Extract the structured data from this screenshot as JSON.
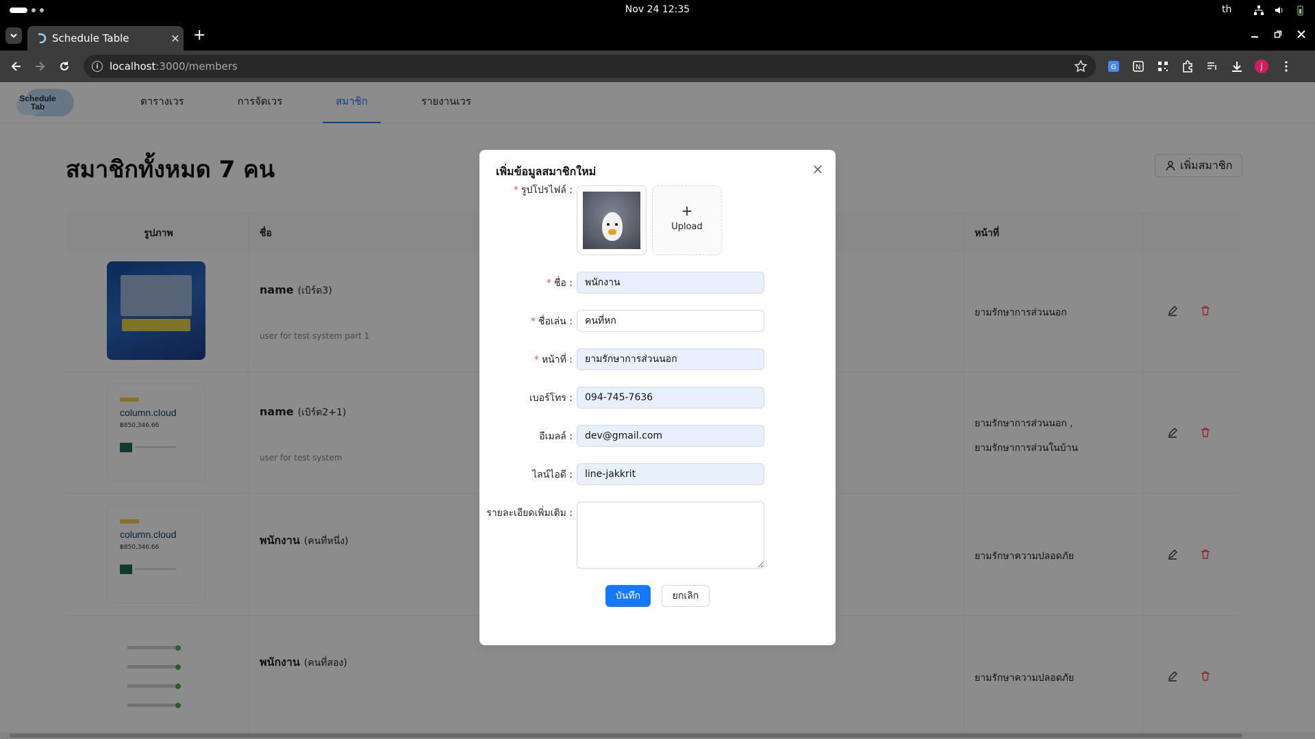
{
  "os": {
    "clock": "Nov 24  12:35",
    "lang": "th"
  },
  "browser": {
    "tab_title": "Schedule Table",
    "new_tab": "+",
    "url_host": "localhost",
    "url_path": ":3000/members",
    "profile_initial": "j"
  },
  "app": {
    "logo_line1": "Schedule",
    "logo_line2": "Tab",
    "nav": [
      "ตารางเวร",
      "การจัดเวร",
      "สมาชิก",
      "รายงานเวร"
    ],
    "active_nav": "สมาชิก",
    "page_title": "สมาชิกทั้งหมด 7 คน",
    "add_member": "เพิ่มสมาชิก",
    "table": {
      "headers": {
        "photo": "รูปภาพ",
        "name": "ชื่อ",
        "role": "หน้าที่"
      },
      "rows": [
        {
          "name": "name",
          "nick": "(เบิร์ด3)",
          "desc": "user for test system part 1",
          "role_1": "ยามรักษาการส่วนนอก",
          "role_2": ""
        },
        {
          "name": "name",
          "nick": "(เบิร์ด2+1)",
          "desc": "user for test system",
          "role_1": "ยามรักษาการส่วนนอก ,",
          "role_2": "ยามรักษาการส่วนในบ้าน"
        },
        {
          "name": "พนักงาน",
          "nick": "(คนที่หนึ่ง)",
          "desc": "",
          "role_1": "ยามรักษาความปลอดภัย",
          "role_2": ""
        },
        {
          "name": "พนักงาน",
          "nick": "(คนที่สอง)",
          "desc": "",
          "role_1": "ยามรักษาความปลอดภัย",
          "role_2": ""
        }
      ],
      "doc_thumb_title": "column.cloud",
      "doc_thumb_amount": "฿850,346.66"
    }
  },
  "modal": {
    "title": "เพิ่มข้อมูลสมาชิกใหม่",
    "close": "×",
    "upload_plus": "+",
    "upload_label": "Upload",
    "fields": {
      "avatar_label": "รูปโปรไฟล์",
      "name_label": "ชื่อ",
      "name_value": "พนักงาน",
      "nickname_label": "ชื่อเล่น",
      "nickname_value": "คนที่หก",
      "role_label": "หน้าที่",
      "role_value": "ยามรักษาการส่วนนอก",
      "phone_label": "เบอร์โทร",
      "phone_value": "094-745-7636",
      "email_label": "อีเมลล์",
      "email_value": "dev@gmail.com",
      "line_label": "ไลน์ไอดี",
      "line_value": "line-jakkrit",
      "detail_label": "รายละเอียดเพิ่มเติม"
    },
    "save": "บันทึก",
    "cancel": "ยกเลิก"
  },
  "colors": {
    "primary": "#1677ff",
    "danger": "#ff4d4f",
    "required": "#ff4d4f"
  },
  "icons": [
    "back-icon",
    "forward-icon",
    "reload-icon",
    "star-icon",
    "user-icon",
    "edit-icon",
    "trash-icon",
    "close-icon"
  ]
}
